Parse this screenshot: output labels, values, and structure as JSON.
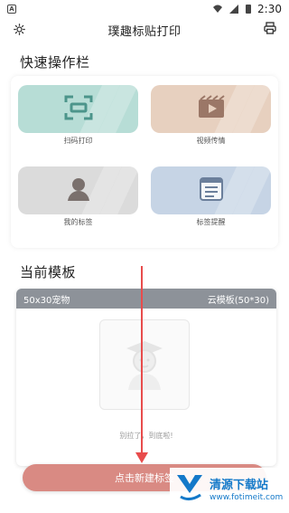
{
  "status_bar": {
    "time": "2:30"
  },
  "header": {
    "title": "璞趣标贴打印"
  },
  "quick_bar": {
    "title": "快速操作栏",
    "tiles": [
      {
        "label": "扫码打印",
        "icon": "scan-print-icon",
        "color": "#b7ddd6"
      },
      {
        "label": "视频传情",
        "icon": "video-icon",
        "color": "#e7d0bf"
      },
      {
        "label": "我的标签",
        "icon": "user-icon",
        "color": "#dbdbdb"
      },
      {
        "label": "标签提醒",
        "icon": "list-icon",
        "color": "#c6d4e5"
      }
    ]
  },
  "current_template": {
    "title": "当前模板",
    "label_name": "50x30宠物",
    "cloud_template": "云模板(50*30)",
    "empty_hint": "别拉了，到底啦!"
  },
  "actions": {
    "create_label": "点击新建标签"
  },
  "watermark": {
    "title": "清源下载站",
    "url": "www.fotimeit.com"
  },
  "colors": {
    "create_button": "#d98a83",
    "template_header": "#8d9299",
    "annotation": "#e84c4c",
    "watermark_blue": "#1479c9"
  }
}
